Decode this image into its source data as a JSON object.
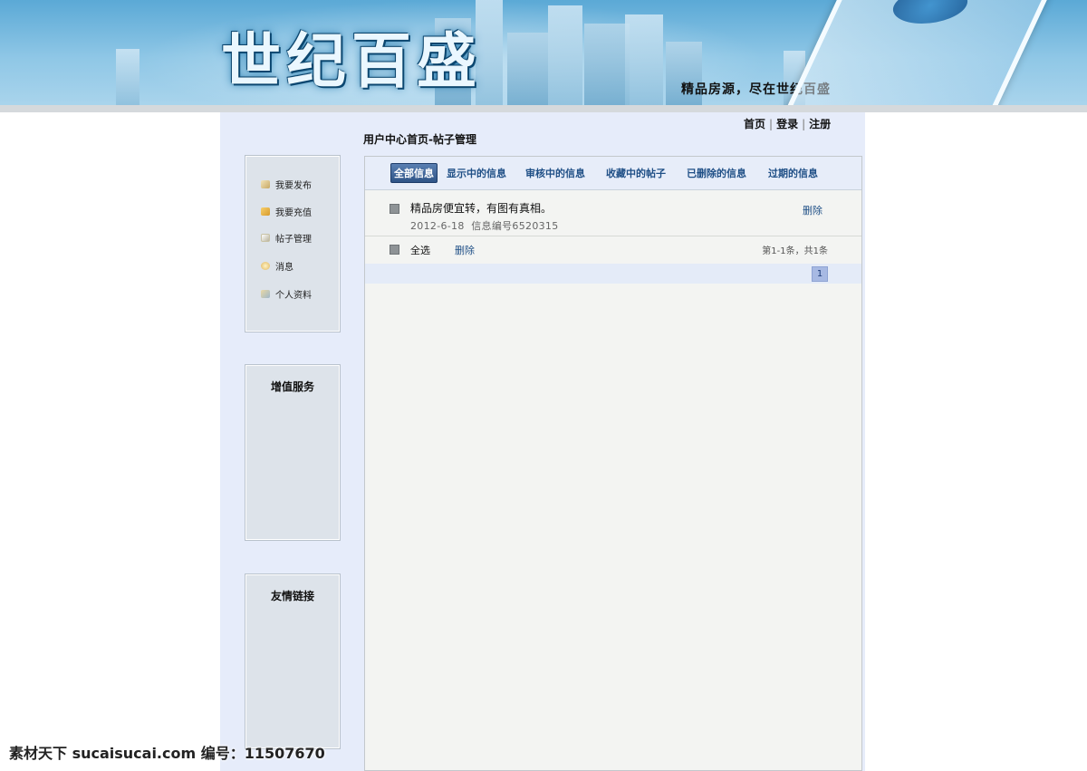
{
  "banner": {
    "logo": "世纪百盛",
    "slogan": "精品房源，尽在世纪百盛"
  },
  "header": {
    "links": [
      {
        "label": "首页"
      },
      {
        "label": "登录"
      },
      {
        "label": "注册"
      }
    ],
    "breadcrumb": "用户中心首页-帖子管理"
  },
  "sidebar": {
    "items": [
      {
        "label": "我要发布",
        "icon": "post-icon"
      },
      {
        "label": "我要充值",
        "icon": "recharge-icon"
      },
      {
        "label": "帖子管理",
        "icon": "edit-icon"
      },
      {
        "label": "消息",
        "icon": "message-icon"
      },
      {
        "label": "个人资料",
        "icon": "profile-icon"
      }
    ],
    "services_title": "增值服务",
    "links_title": "友情链接"
  },
  "tabs": [
    {
      "label": "全部信息",
      "active": true
    },
    {
      "label": "显示中的信息"
    },
    {
      "label": "审核中的信息"
    },
    {
      "label": "收藏中的帖子"
    },
    {
      "label": "已删除的信息"
    },
    {
      "label": "过期的信息"
    }
  ],
  "posts": [
    {
      "title": "精品房便宜转，有图有真相。",
      "date": "2012-6-18",
      "id_label": "信息编号6520315",
      "delete_label": "删除"
    }
  ],
  "bulk": {
    "select_all": "全选",
    "delete": "删除",
    "count": "第1-1条，共1条"
  },
  "pager": {
    "current": "1"
  },
  "watermark": "素材天下 sucaisucai.com  编号：11507670",
  "colors": {
    "banner_blue": "#5ba9d6",
    "page_bg": "#e6ecfa",
    "link_blue": "#1f4f86",
    "active_tab": "#2f5487"
  }
}
